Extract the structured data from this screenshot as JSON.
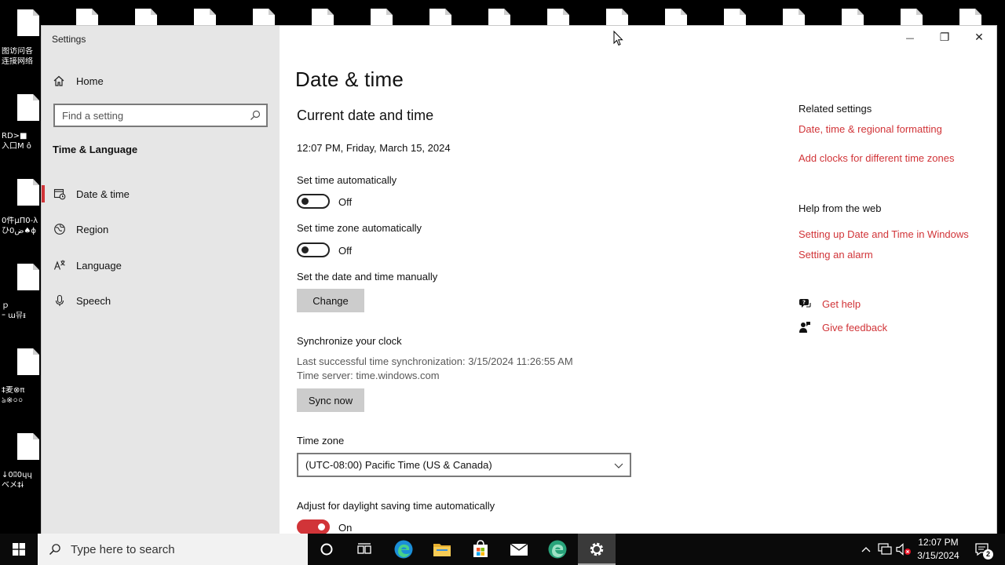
{
  "desktop": {
    "labels": [
      "图访问各",
      "连接网络",
      "RD>■",
      "入口M ô",
      "0件μΠ0-λ",
      "ひض0♠ɸ",
      "ｐ",
      "ｰ ɯ뮤ᵻ",
      "‡麦⊗π",
      "ঌ※০০",
      "↓0ﾛ0ɥɥ",
      "ベメ‡ɨ"
    ]
  },
  "window": {
    "title": "Settings",
    "controls": {
      "minimize": "—",
      "restore": "❐",
      "close": "✕"
    }
  },
  "sidebar": {
    "home_label": "Home",
    "search_placeholder": "Find a setting",
    "section_title": "Time & Language",
    "items": [
      {
        "label": "Date & time",
        "icon": "calendar-clock-icon",
        "active": true
      },
      {
        "label": "Region",
        "icon": "globe-icon",
        "active": false
      },
      {
        "label": "Language",
        "icon": "language-icon",
        "active": false
      },
      {
        "label": "Speech",
        "icon": "microphone-icon",
        "active": false
      }
    ]
  },
  "main": {
    "page_title": "Date & time",
    "section_title": "Current date and time",
    "current_datetime": "12:07 PM, Friday, March 15, 2024",
    "set_time_auto": {
      "label": "Set time automatically",
      "state": "Off"
    },
    "set_tz_auto": {
      "label": "Set time zone automatically",
      "state": "Off"
    },
    "manual": {
      "label": "Set the date and time manually",
      "button": "Change"
    },
    "sync": {
      "title": "Synchronize your clock",
      "last_sync": "Last successful time synchronization: 3/15/2024 11:26:55 AM",
      "server": "Time server: time.windows.com",
      "button": "Sync now"
    },
    "time_zone": {
      "label": "Time zone",
      "value": "(UTC-08:00) Pacific Time (US & Canada)"
    },
    "dst": {
      "label": "Adjust for daylight saving time automatically",
      "state": "On"
    }
  },
  "related": {
    "title": "Related settings",
    "links": [
      "Date, time & regional formatting",
      "Add clocks for different time zones"
    ]
  },
  "help_web": {
    "title": "Help from the web",
    "links": [
      "Setting up Date and Time in Windows",
      "Setting an alarm"
    ]
  },
  "help_actions": {
    "get_help": "Get help",
    "give_feedback": "Give feedback"
  },
  "taskbar": {
    "search_placeholder": "Type here to search",
    "apps": [
      "cortana-icon",
      "task-view-icon",
      "edge-icon",
      "file-explorer-icon",
      "store-icon",
      "mail-icon",
      "edge-dev-icon",
      "settings-icon"
    ],
    "clock_time": "12:07 PM",
    "clock_date": "3/15/2024",
    "notification_count": "2"
  },
  "colors": {
    "accent": "#d13438",
    "sidebar_bg": "#e6e6e6",
    "taskbar_bg": "#0a0a0a"
  }
}
